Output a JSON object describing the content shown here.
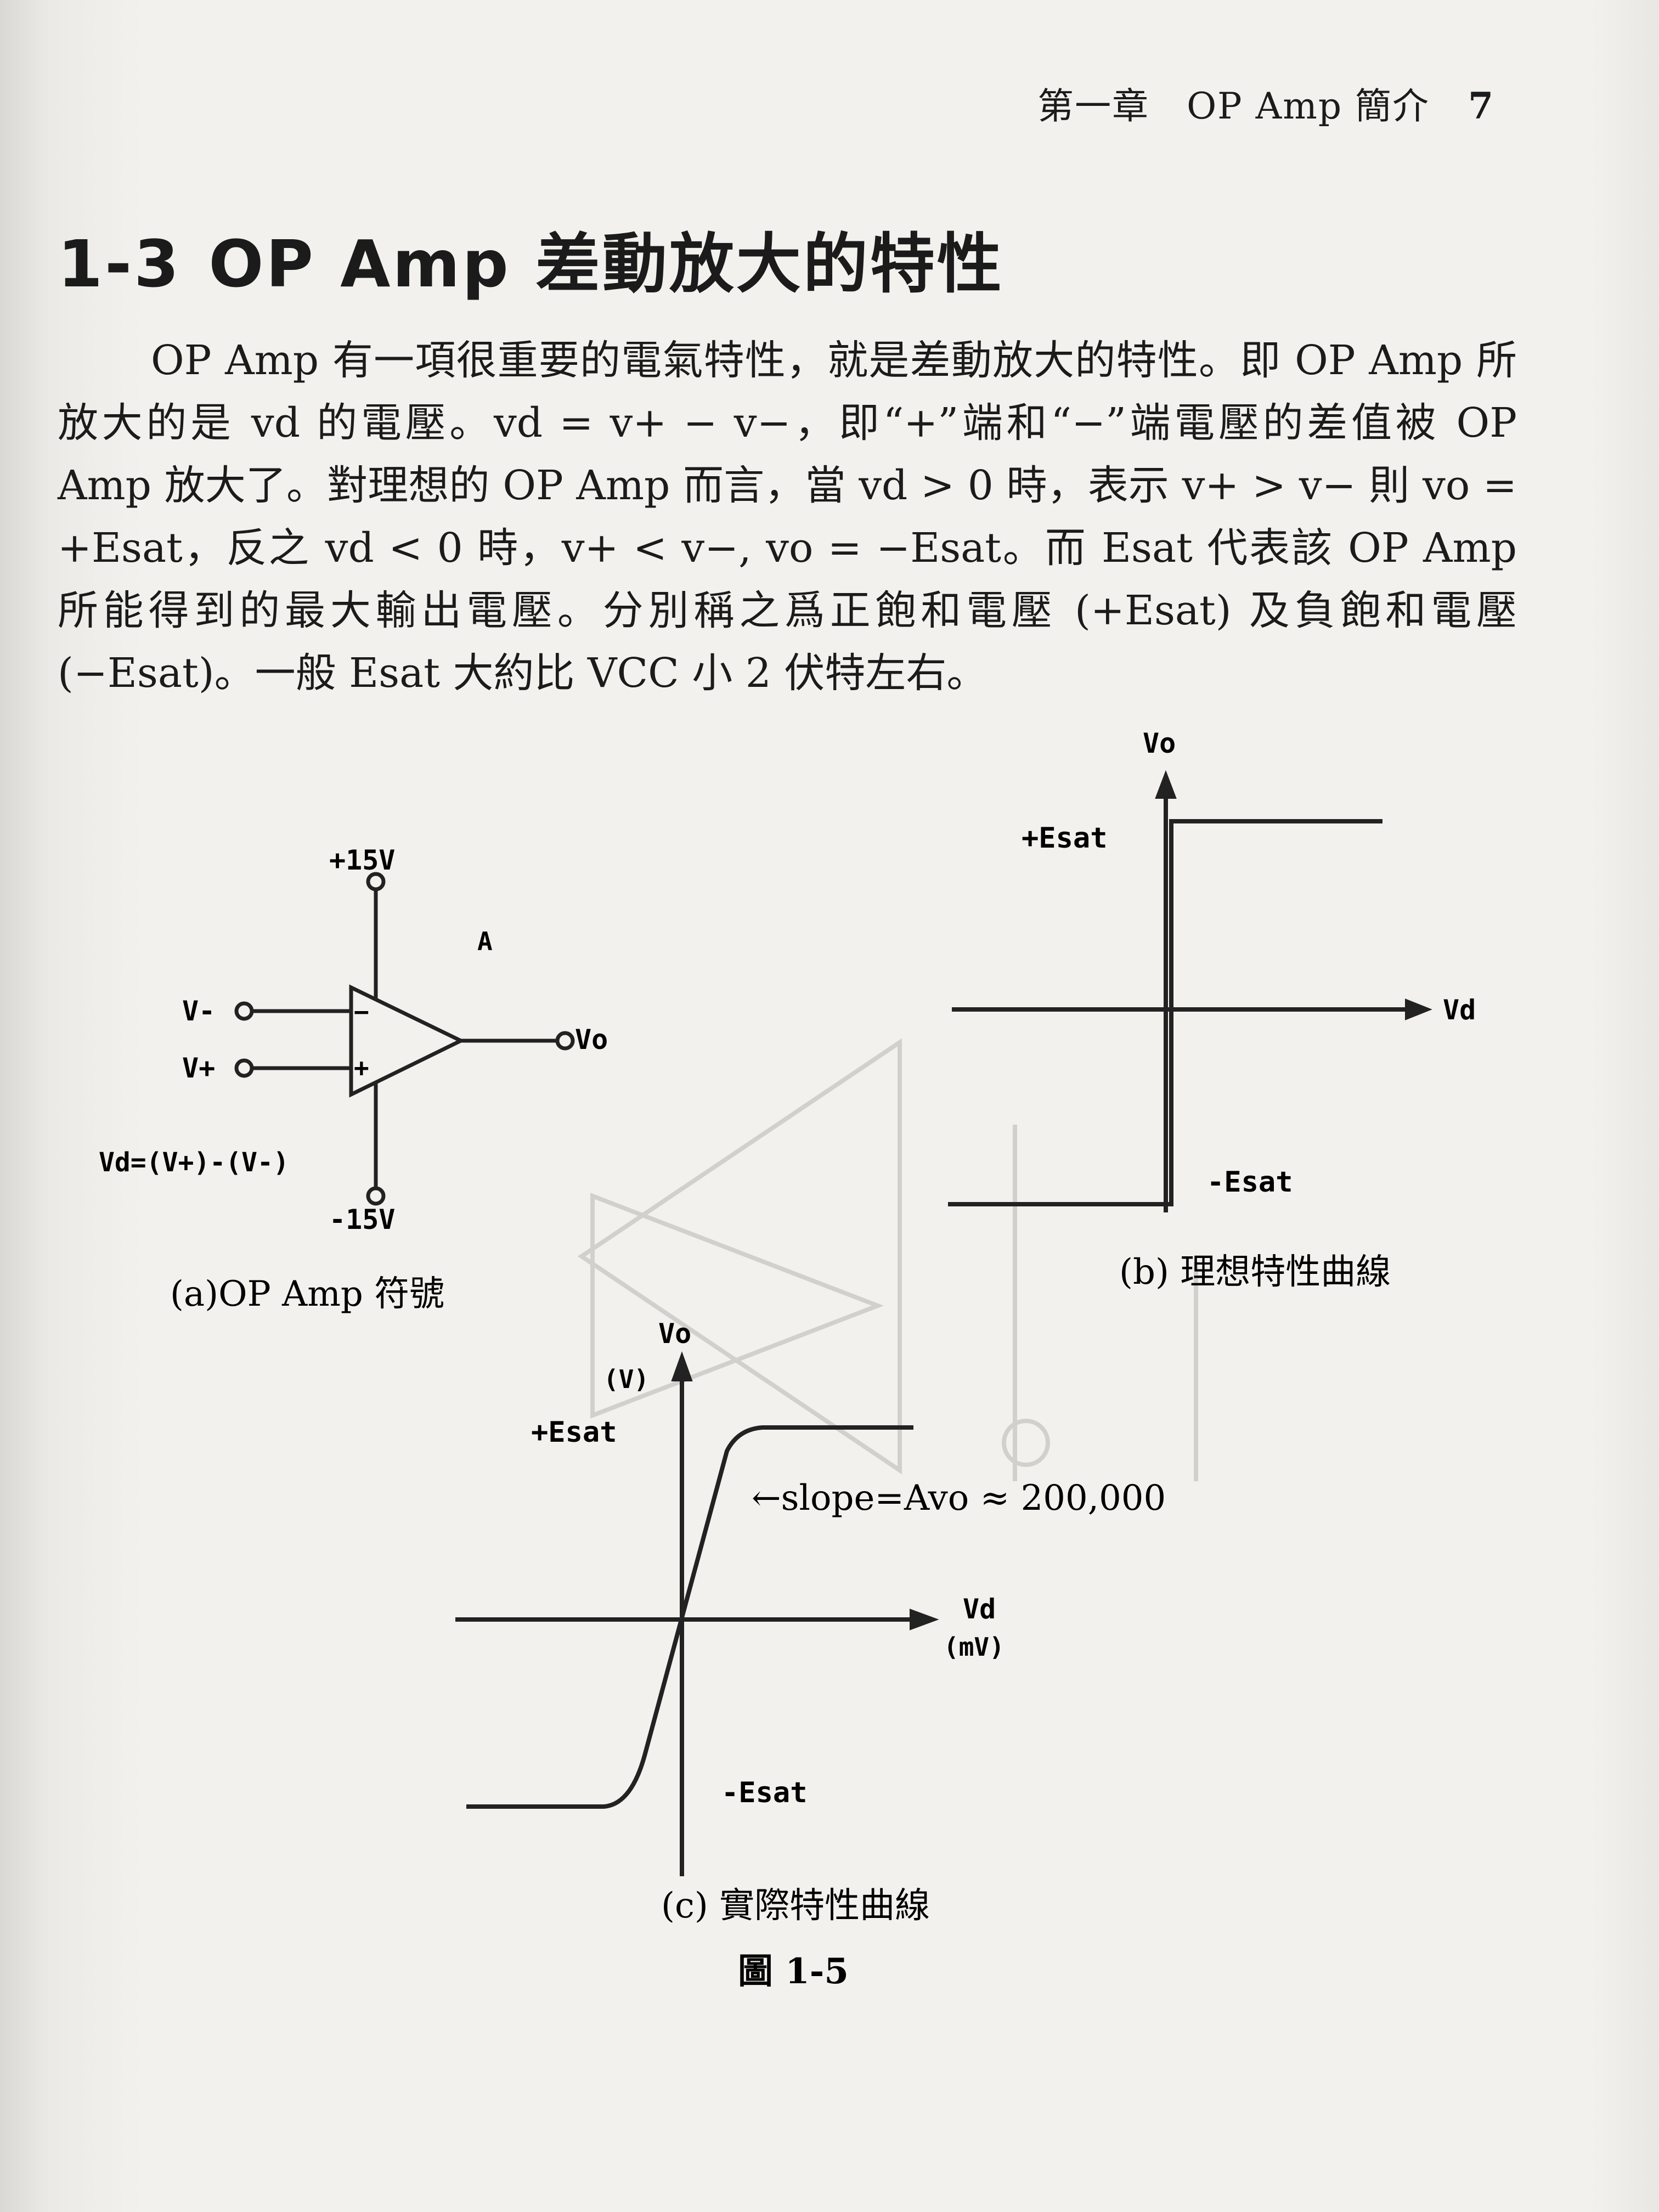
{
  "header": {
    "chapter": "第一章　OP Amp 簡介",
    "page_number": "7"
  },
  "section": {
    "number": "1-3",
    "title": "OP Amp 差動放大的特性"
  },
  "paragraph": "OP Amp 有一項很重要的電氣特性，就是差動放大的特性。即 OP Amp 所放大的是 vd 的電壓。vd = v+ − v−，即“+”端和“−”端電壓的差值被 OP Amp 放大了。對理想的 OP Amp 而言，當 vd > 0 時，表示 v+ > v− 則 vo = +Esat，反之 vd < 0 時，v+ < v−, vo = −Esat。而 Esat 代表該 OP Amp 所能得到的最大輸出電壓。分別稱之爲正飽和電壓 (+Esat) 及負飽和電壓 (−Esat)。一般 Esat 大約比 VCC 小 2 伏特左右。",
  "figure_a": {
    "supply_pos": "+15V",
    "supply_neg": "-15V",
    "amp_label": "A",
    "input_neg": "V-",
    "input_pos": "V+",
    "minus_sign": "−",
    "plus_sign": "+",
    "output": "Vo",
    "equation": "Vd=(V+)-(V-)",
    "caption": "(a)OP Amp 符號"
  },
  "figure_b": {
    "y_label": "Vo",
    "x_label": "Vd",
    "pos_sat": "+Esat",
    "neg_sat": "-Esat",
    "caption": "(b) 理想特性曲線"
  },
  "figure_c": {
    "y_label": "Vo",
    "y_unit": "(V)",
    "x_label": "Vd",
    "x_unit": "(mV)",
    "pos_sat": "+Esat",
    "neg_sat": "-Esat",
    "slope_note": "←slope=Avo ≈ 200,000",
    "caption": "(c) 實際特性曲線"
  },
  "figure_number": "圖 1-5"
}
